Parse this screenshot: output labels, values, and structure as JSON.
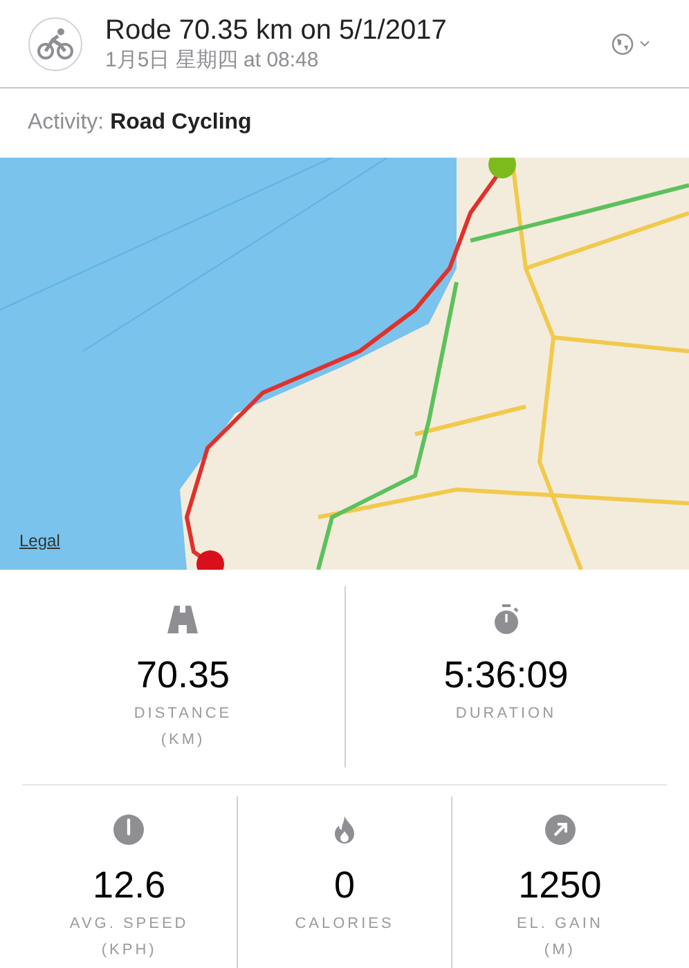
{
  "header": {
    "title": "Rode 70.35 km on 5/1/2017",
    "subtitle": "1月5日 星期四 at 08:48"
  },
  "activity": {
    "label": "Activity:",
    "value": "Road Cycling"
  },
  "map": {
    "kind": "picture",
    "legal_link": "Legal"
  },
  "stats_top": [
    {
      "value": "70.35",
      "label": "DISTANCE",
      "unit": "(KM)"
    },
    {
      "value": "5:36:09",
      "label": "DURATION"
    }
  ],
  "stats_bottom": [
    {
      "value": "12.6",
      "label": "AVG. SPEED",
      "unit": "(KPH)"
    },
    {
      "value": "0",
      "label": "CALORIES"
    },
    {
      "value": "1250",
      "label": "EL. GAIN",
      "unit": "(M)"
    }
  ]
}
